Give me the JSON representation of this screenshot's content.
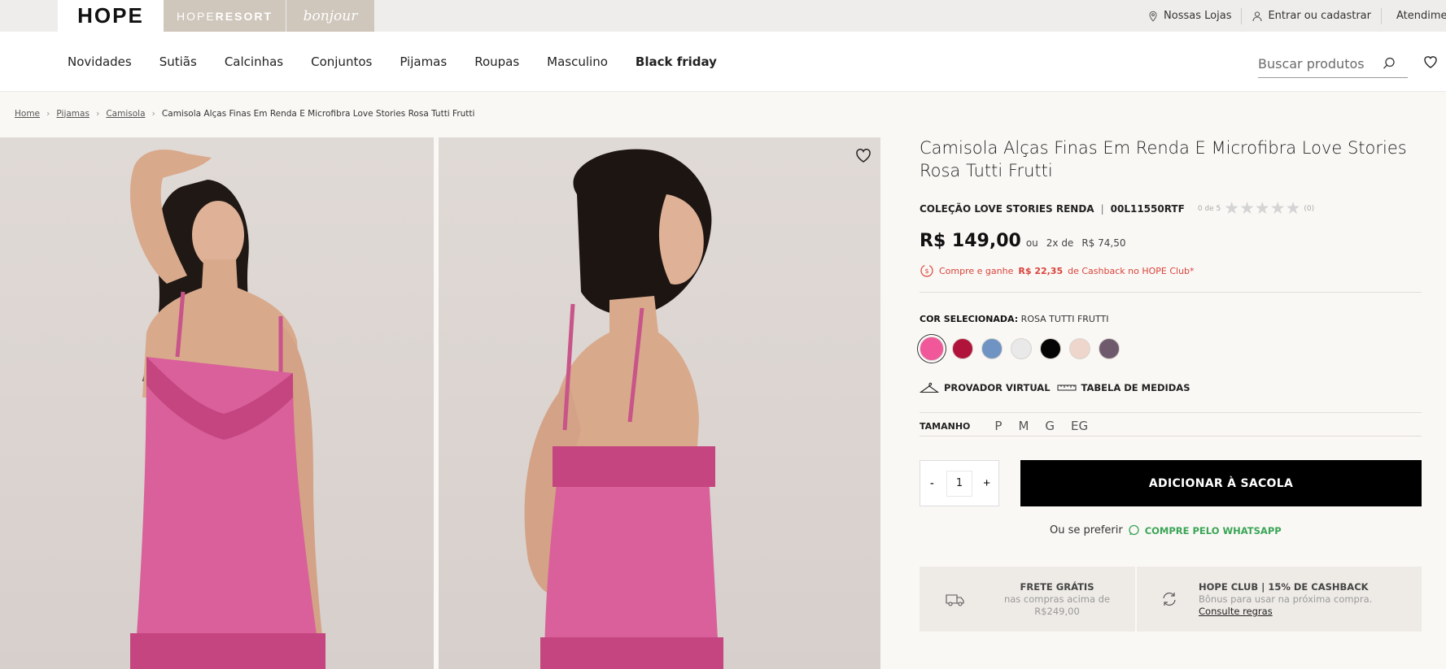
{
  "brands": {
    "hope": "HOPE",
    "resort_prefix": "HOPE",
    "resort_suffix": "RESORT",
    "bonjour": "bonjour"
  },
  "top_links": {
    "stores": "Nossas Lojas",
    "login": "Entrar ou cadastrar",
    "service": "Atendimento"
  },
  "nav": {
    "items": [
      "Novidades",
      "Sutiãs",
      "Calcinhas",
      "Conjuntos",
      "Pijamas",
      "Roupas",
      "Masculino",
      "Black friday"
    ],
    "search_placeholder": "Buscar produtos"
  },
  "breadcrumb": {
    "home": "Home",
    "pijamas": "Pijamas",
    "camisola": "Camisola",
    "current": "Camisola Alças Finas Em Renda E Microfibra Love Stories Rosa Tutti Frutti"
  },
  "product": {
    "title": "Camisola Alças Finas Em Renda E Microfibra Love Stories Rosa Tutti Frutti",
    "collection": "COLEÇÃO LOVE STORIES RENDA",
    "sku": "00L11550RTF",
    "rating_text": "0 de 5",
    "rating_value": 0,
    "rating_max": 5,
    "review_count": "(0)",
    "price": "R$ 149,00",
    "installments_prefix": "ou",
    "installments_count": "2x de",
    "installments_value": "R$ 74,50",
    "cashback_prefix": "Compre e ganhe",
    "cashback_amount": "R$ 22,35",
    "cashback_suffix": "de Cashback no HOPE Club*",
    "color_label": "COR SELECIONADA:",
    "color_value": "ROSA TUTTI FRUTTI",
    "colors": [
      "#f0589a",
      "#b0143a",
      "#6f94c4",
      "#e9e9e9",
      "#050505",
      "#efd6cc",
      "#6e5a6c"
    ],
    "provador": "PROVADOR VIRTUAL",
    "tabela": "TABELA DE MEDIDAS",
    "size_label": "TAMANHO",
    "sizes": [
      "P",
      "M",
      "G",
      "EG"
    ],
    "qty_minus": "-",
    "qty_value": "1",
    "qty_plus": "+",
    "add_button": "ADICIONAR À SACOLA",
    "prefer_text": "Ou se preferir",
    "whatsapp": "COMPRE PELO WHATSAPP"
  },
  "benefits": {
    "shipping_title": "FRETE GRÁTIS",
    "shipping_line1": "nas compras acima de",
    "shipping_line2": "R$249,00",
    "club_title": "HOPE CLUB | 15% DE CASHBACK",
    "club_line1": "Bônus para usar na próxima compra.",
    "club_link": "Consulte regras"
  },
  "colors_ui": {
    "accent_red": "#d9433b",
    "whatsapp_green": "#3aa556",
    "dress_pink": "#d9609a"
  }
}
